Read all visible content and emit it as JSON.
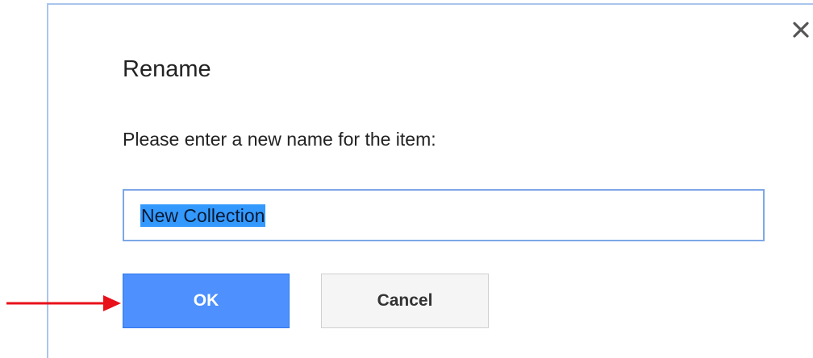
{
  "dialog": {
    "title": "Rename",
    "message": "Please enter a new name for the item:",
    "close_icon": "close-icon",
    "input": {
      "value": "New Collection",
      "selected": true
    },
    "buttons": {
      "ok_label": "OK",
      "cancel_label": "Cancel"
    }
  },
  "annotation": {
    "arrow_icon": "red-arrow-right",
    "arrow_color": "#e8101a",
    "points_to": "ok-button"
  },
  "colors": {
    "primary_button": "#4d90fe",
    "input_border": "#7ea7e6",
    "dialog_border": "#a9c6ec",
    "selection_highlight": "#3399ff"
  }
}
